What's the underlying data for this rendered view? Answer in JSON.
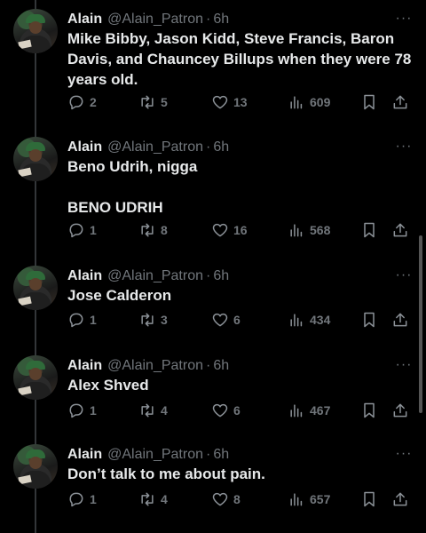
{
  "tweets": [
    {
      "name": "Alain",
      "handle": "@Alain_Patron",
      "time": "6h",
      "text": "Mike Bibby, Jason Kidd, Steve Francis, Baron Davis, and Chauncey Billups when they were 78 years old.",
      "replies": "2",
      "reposts": "5",
      "likes": "13",
      "views": "609"
    },
    {
      "name": "Alain",
      "handle": "@Alain_Patron",
      "time": "6h",
      "text": "Beno Udrih, nigga\n\nBENO UDRIH",
      "replies": "1",
      "reposts": "8",
      "likes": "16",
      "views": "568"
    },
    {
      "name": "Alain",
      "handle": "@Alain_Patron",
      "time": "6h",
      "text": "Jose Calderon",
      "replies": "1",
      "reposts": "3",
      "likes": "6",
      "views": "434"
    },
    {
      "name": "Alain",
      "handle": "@Alain_Patron",
      "time": "6h",
      "text": "Alex Shved",
      "replies": "1",
      "reposts": "4",
      "likes": "6",
      "views": "467"
    },
    {
      "name": "Alain",
      "handle": "@Alain_Patron",
      "time": "6h",
      "text": "Don’t talk to me about pain.",
      "replies": "1",
      "reposts": "4",
      "likes": "8",
      "views": "657"
    }
  ],
  "icons": {
    "more": "more-icon",
    "reply": "reply-icon",
    "repost": "repost-icon",
    "like": "heart-icon",
    "views": "views-icon",
    "bookmark": "bookmark-icon",
    "share": "share-icon"
  },
  "colors": {
    "background": "#000000",
    "text": "#e7e9ea",
    "muted": "#71767b"
  }
}
